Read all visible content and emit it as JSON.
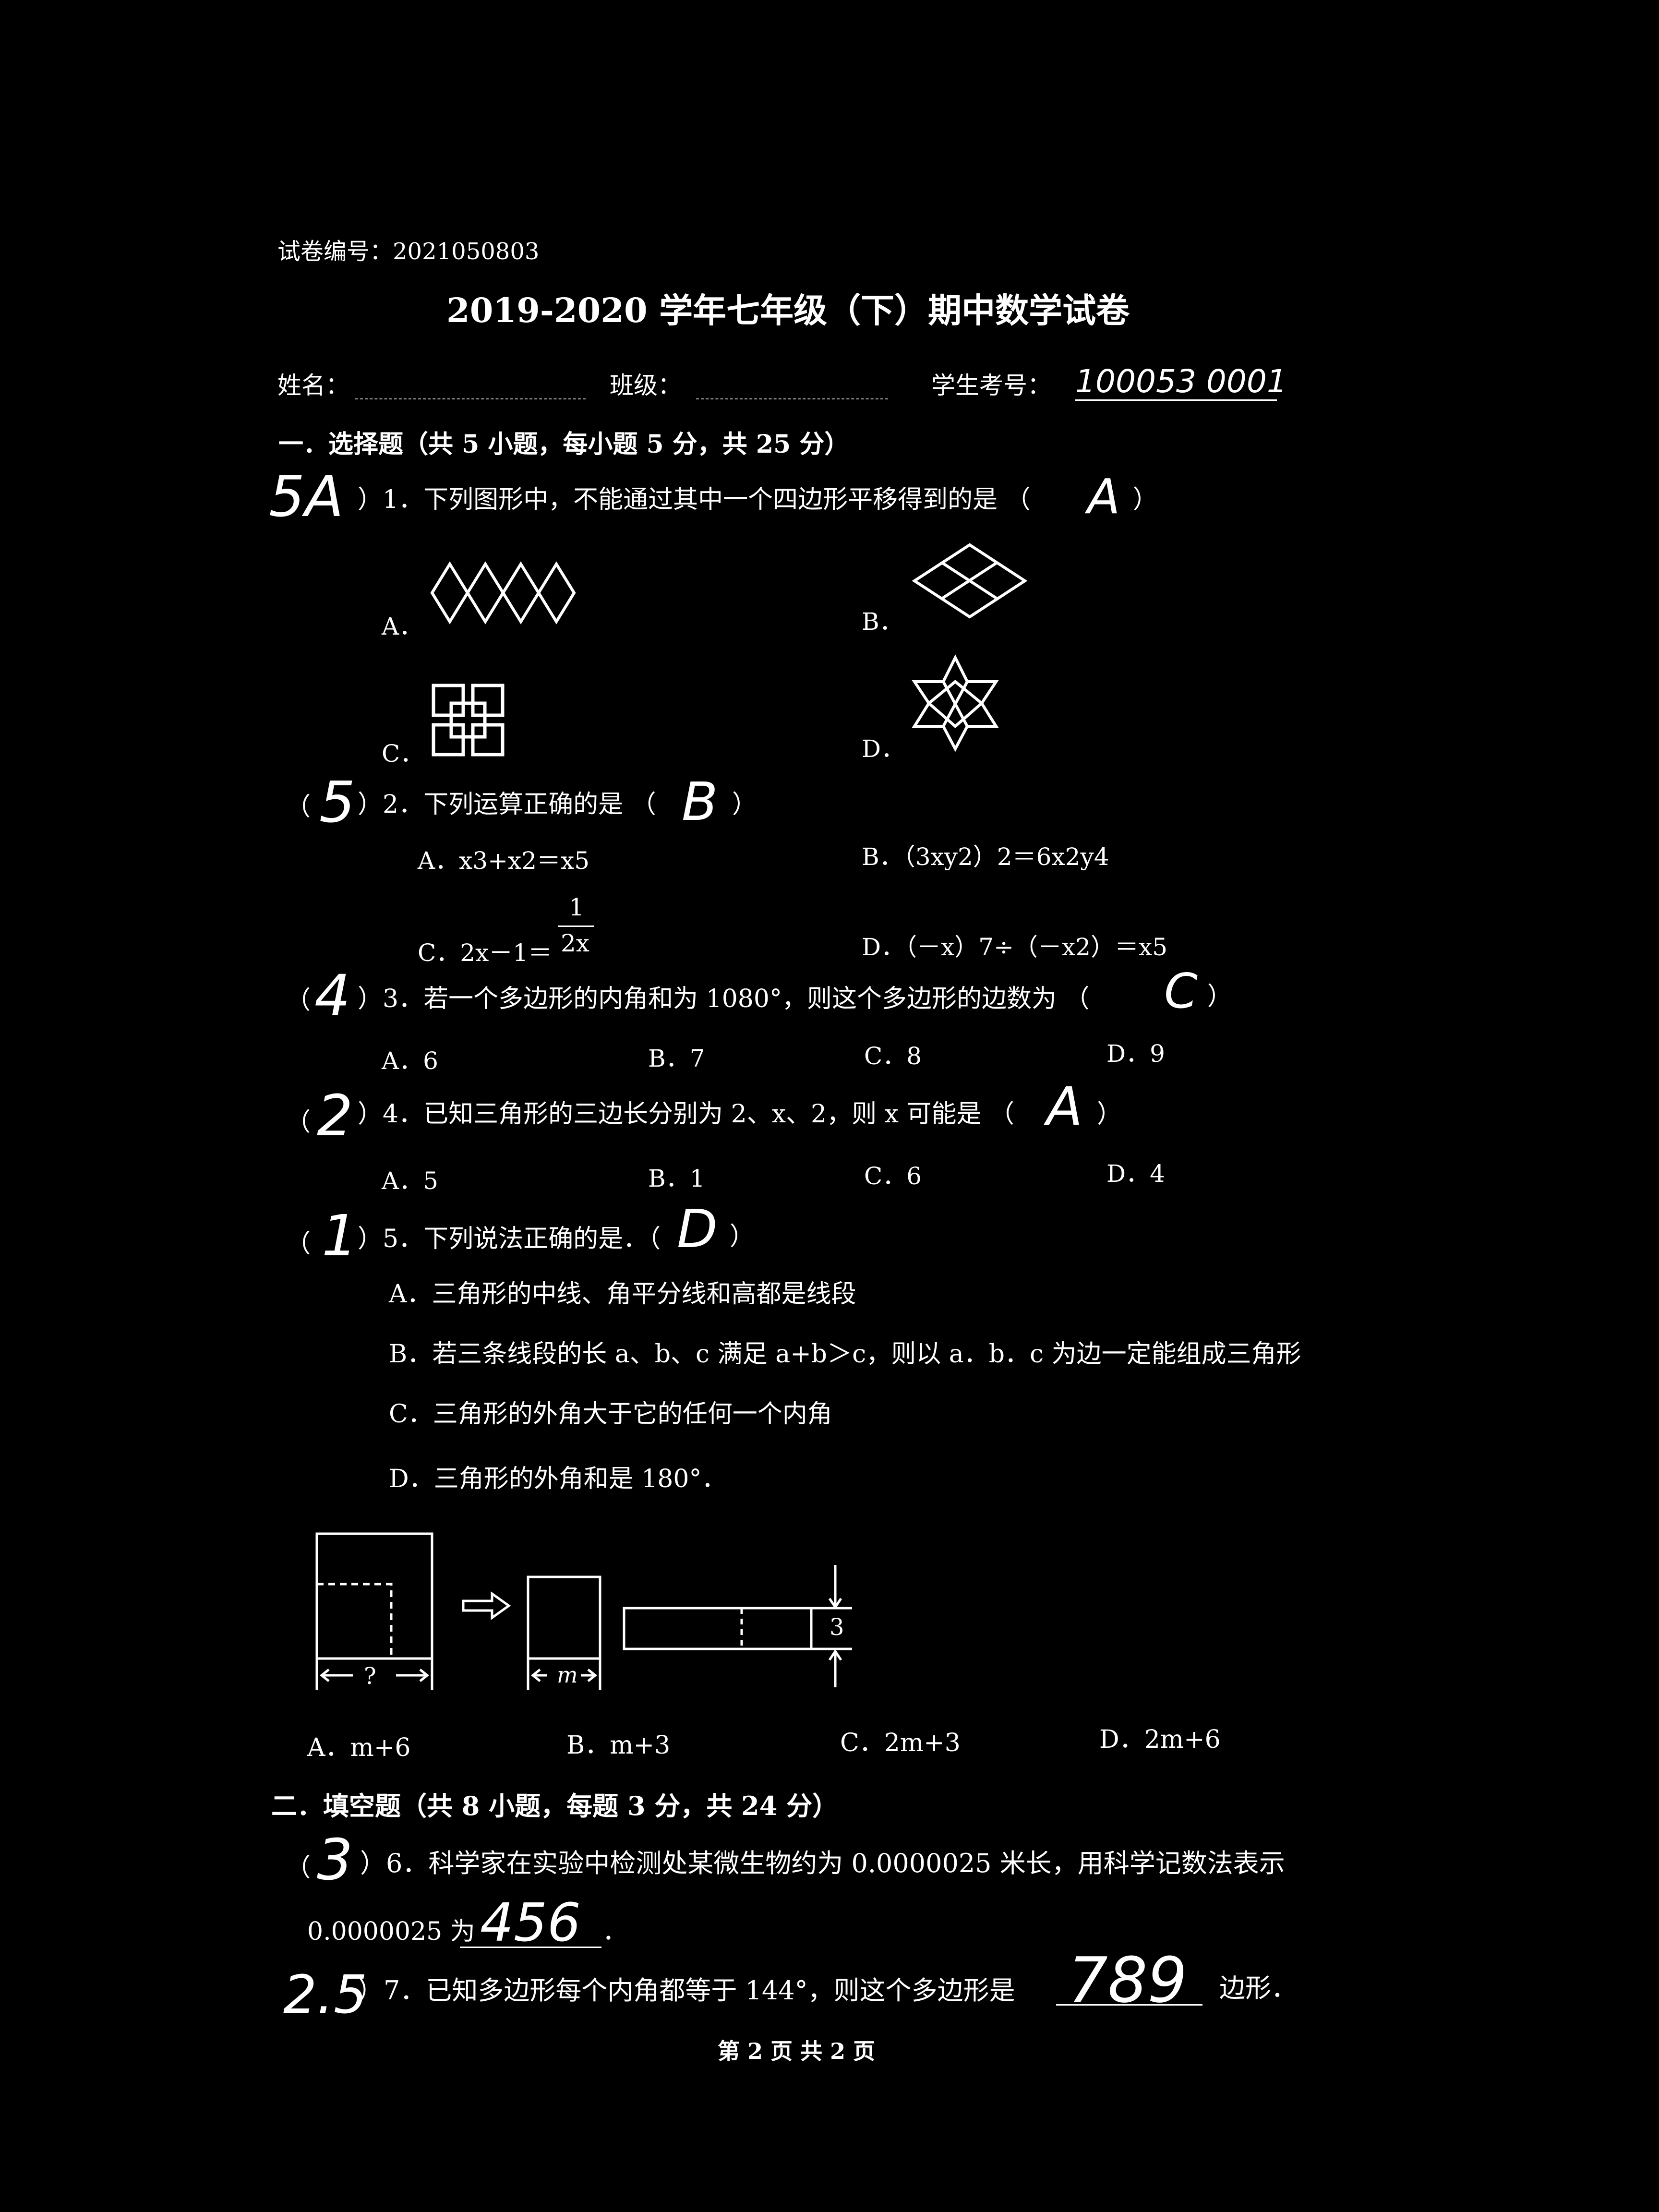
{
  "header": {
    "paper_id": "试卷编号：2021050803",
    "title": "2019-2020 学年七年级（下）期中数学试卷",
    "name_label": "姓名：",
    "class_label": "班级：",
    "student_id_label": "学生考号：",
    "student_id_value": "100053 0001"
  },
  "section1": {
    "heading": "一．选择题（共 5 小题，每小题 5 分，共 25 分）",
    "q1": {
      "mark": "5A",
      "text": "）1．下列图形中，不能通过其中一个四边形平移得到的是 （",
      "answer": "A",
      "close": "）",
      "options": [
        "A．",
        "B．",
        "C．",
        "D．"
      ]
    },
    "q2": {
      "open": "（",
      "mark": "5",
      "text": "）2．下列运算正确的是 （",
      "answer": "B",
      "close": "）",
      "opt_a": "A．x3+x2＝x5",
      "opt_b": "B．（3xy2）2＝6x2y4",
      "opt_c_prefix": "C．2x－1＝",
      "opt_c_num": "1",
      "opt_c_den": "2x",
      "opt_d": "D．（－x）7÷（－x2）＝x5"
    },
    "q3": {
      "open": "（",
      "mark": "4",
      "text": "）3．若一个多边形的内角和为 1080°，则这个多边形的边数为 （",
      "answer": "C",
      "close": "）",
      "options": [
        "A．6",
        "B．7",
        "C．8",
        "D．9"
      ]
    },
    "q4": {
      "open": "（",
      "mark": "2",
      "text": "）4．已知三角形的三边长分别为 2、x、2，则 x 可能是 （",
      "answer": "A",
      "close": "）",
      "options": [
        "A．5",
        "B．1",
        "C．6",
        "D．4"
      ]
    },
    "q5": {
      "open": "（",
      "mark": "1",
      "text": "）5．下列说法正确的是．（",
      "answer": "D",
      "close": "）",
      "opt_a": "A．三角形的中线、角平分线和高都是线段",
      "opt_b": "B．若三条线段的长 a、b、c 满足 a+b＞c，则以 a．b．c 为边一定能组成三角形",
      "opt_c": "C．三角形的外角大于它的任何一个内角",
      "opt_d": "D．三角形的外角和是 180°．"
    },
    "figure": {
      "question_mark": "?",
      "m_label": "m",
      "three_label": "3"
    },
    "extra_options": [
      "A．m+6",
      "B．m+3",
      "C．2m+3",
      "D．2m+6"
    ]
  },
  "section2": {
    "heading": "二．填空题（共 8 小题，每题 3 分，共 24 分）",
    "q6": {
      "open": "（",
      "mark": "3",
      "text": "）6．科学家在实验中检测处某微生物约为 0.0000025 米长，用科学记数法表示",
      "line2": "0.0000025 为",
      "answer": "456",
      "end": "．"
    },
    "q7": {
      "mark": "2.5",
      "text": "）7．已知多边形每个内角都等于 144°，则这个多边形是",
      "answer": "789",
      "end": "边形．"
    }
  },
  "footer": {
    "page": "第 2 页 共 2 页"
  }
}
